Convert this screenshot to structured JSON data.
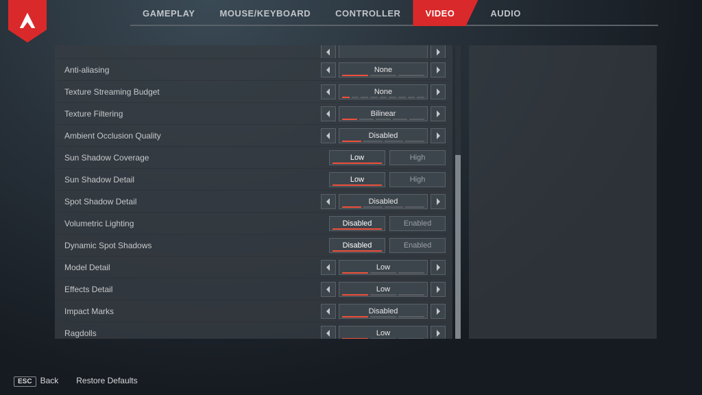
{
  "tabs": [
    "GAMEPLAY",
    "MOUSE/KEYBOARD",
    "CONTROLLER",
    "VIDEO",
    "AUDIO"
  ],
  "active_tab": 3,
  "footer": {
    "back_key": "ESC",
    "back_label": "Back",
    "restore": "Restore Defaults"
  },
  "settings": [
    {
      "label": "",
      "type": "cutoff"
    },
    {
      "label": "Anti-aliasing",
      "type": "stepper",
      "value": "None",
      "ticks": 3,
      "tick_on": 1
    },
    {
      "label": "Texture Streaming Budget",
      "type": "stepper",
      "value": "None",
      "ticks": 9,
      "tick_on": 1
    },
    {
      "label": "Texture Filtering",
      "type": "stepper",
      "value": "Bilinear",
      "ticks": 5,
      "tick_on": 1
    },
    {
      "label": "Ambient Occlusion Quality",
      "type": "stepper",
      "value": "Disabled",
      "ticks": 4,
      "tick_on": 1
    },
    {
      "label": "Sun Shadow Coverage",
      "type": "toggle",
      "options": [
        "Low",
        "High"
      ],
      "sel": 0
    },
    {
      "label": "Sun Shadow Detail",
      "type": "toggle",
      "options": [
        "Low",
        "High"
      ],
      "sel": 0
    },
    {
      "label": "Spot Shadow Detail",
      "type": "stepper",
      "value": "Disabled",
      "ticks": 4,
      "tick_on": 1
    },
    {
      "label": "Volumetric Lighting",
      "type": "toggle",
      "options": [
        "Disabled",
        "Enabled"
      ],
      "sel": 0
    },
    {
      "label": "Dynamic Spot Shadows",
      "type": "toggle",
      "options": [
        "Disabled",
        "Enabled"
      ],
      "sel": 0
    },
    {
      "label": "Model Detail",
      "type": "stepper",
      "value": "Low",
      "ticks": 3,
      "tick_on": 1
    },
    {
      "label": "Effects Detail",
      "type": "stepper",
      "value": "Low",
      "ticks": 3,
      "tick_on": 1
    },
    {
      "label": "Impact Marks",
      "type": "stepper",
      "value": "Disabled",
      "ticks": 3,
      "tick_on": 1
    },
    {
      "label": "Ragdolls",
      "type": "stepper",
      "value": "Low",
      "ticks": 3,
      "tick_on": 1
    }
  ]
}
